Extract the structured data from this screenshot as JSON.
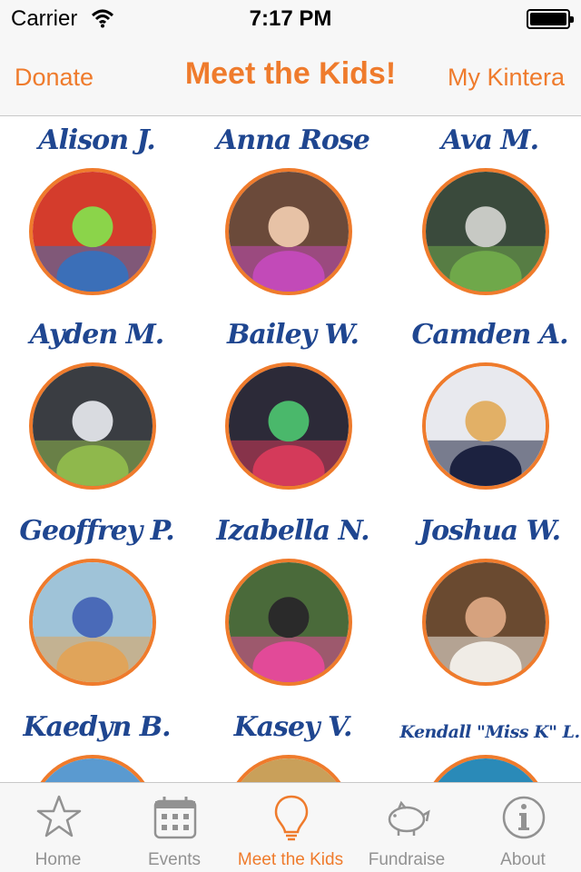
{
  "status_bar": {
    "carrier": "Carrier",
    "time": "7:17 PM"
  },
  "nav": {
    "left_button": "Donate",
    "title": "Meet the Kids!",
    "right_button": "My Kintera"
  },
  "colors": {
    "accent": "#ef7b2c",
    "name_text": "#1f4690",
    "tab_inactive": "#929292"
  },
  "kids": [
    {
      "name": "Alison J.",
      "photo_colors": [
        "#d43c2c",
        "#3b6fb8",
        "#8bd44a"
      ]
    },
    {
      "name": "Anna Rose",
      "photo_colors": [
        "#6b4a3a",
        "#c24ab8",
        "#e7c2a6"
      ]
    },
    {
      "name": "Ava M.",
      "photo_colors": [
        "#3a4a3c",
        "#6fa84a",
        "#c7c9c4"
      ]
    },
    {
      "name": "Ayden M.",
      "photo_colors": [
        "#3a3d42",
        "#8fb84c",
        "#d9dbe0"
      ]
    },
    {
      "name": "Bailey W.",
      "photo_colors": [
        "#2c2a38",
        "#d43a5a",
        "#4ab86b"
      ]
    },
    {
      "name": "Camden A.",
      "photo_colors": [
        "#e8e9ee",
        "#1c2240",
        "#e2b066"
      ]
    },
    {
      "name": "Geoffrey P.",
      "photo_colors": [
        "#9fc3d8",
        "#e0a45a",
        "#4a6ab8"
      ]
    },
    {
      "name": "Izabella N.",
      "photo_colors": [
        "#4a6a3a",
        "#e24a98",
        "#2a2a2a"
      ]
    },
    {
      "name": "Joshua W.",
      "photo_colors": [
        "#6a4a30",
        "#f0ece6",
        "#d6a27e"
      ]
    },
    {
      "name": "Kaedyn B.",
      "photo_colors": [
        "#5a9ad0",
        "#e3b89a",
        "#8fd0e8"
      ]
    },
    {
      "name": "Kasey V.",
      "photo_colors": [
        "#c9a05a",
        "#e8c9a8",
        "#a87a4a"
      ]
    },
    {
      "name": "Kendall \"Miss K\" L.",
      "photo_colors": [
        "#2a8ab8",
        "#e4c2a0",
        "#5ac0e0"
      ]
    }
  ],
  "tabs": [
    {
      "label": "Home",
      "icon": "star-icon",
      "active": false
    },
    {
      "label": "Events",
      "icon": "calendar-icon",
      "active": false
    },
    {
      "label": "Meet the Kids",
      "icon": "lightbulb-icon",
      "active": true
    },
    {
      "label": "Fundraise",
      "icon": "piggy-bank-icon",
      "active": false
    },
    {
      "label": "About",
      "icon": "info-icon",
      "active": false
    }
  ]
}
